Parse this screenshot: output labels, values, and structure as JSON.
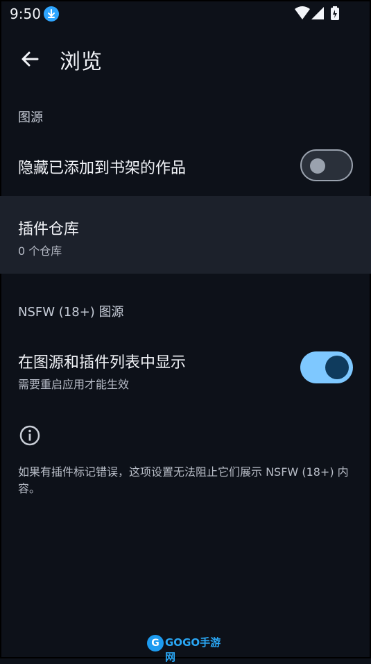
{
  "status": {
    "time": "9:50",
    "icons": [
      "download-icon",
      "wifi-icon",
      "signal-icon",
      "battery-charging-icon"
    ]
  },
  "appbar": {
    "title": "浏览",
    "back_icon": "arrow-left-icon"
  },
  "sections": {
    "source": {
      "header": "图源",
      "hide_in_library": {
        "label": "隐藏已添加到书架的作品",
        "enabled": false
      },
      "extension_repos": {
        "label": "插件仓库",
        "subtitle": "0 个仓库"
      }
    },
    "nsfw": {
      "header": "NSFW (18+) 图源",
      "show_in_lists": {
        "label": "在图源和插件列表中显示",
        "subtitle": "需要重启应用才能生效",
        "enabled": true
      }
    }
  },
  "info": {
    "icon": "info-icon",
    "text": "如果有插件标记错误，这项设置无法阻止它们展示 NSFW (18+) 内容。"
  },
  "watermark": {
    "badge": "G",
    "text": "GOGO手游网"
  },
  "colors": {
    "background": "#0d1119",
    "accent": "#7ec8ff",
    "switch_knob_on": "#0f3b5d",
    "highlight_row": "#1c212b"
  }
}
